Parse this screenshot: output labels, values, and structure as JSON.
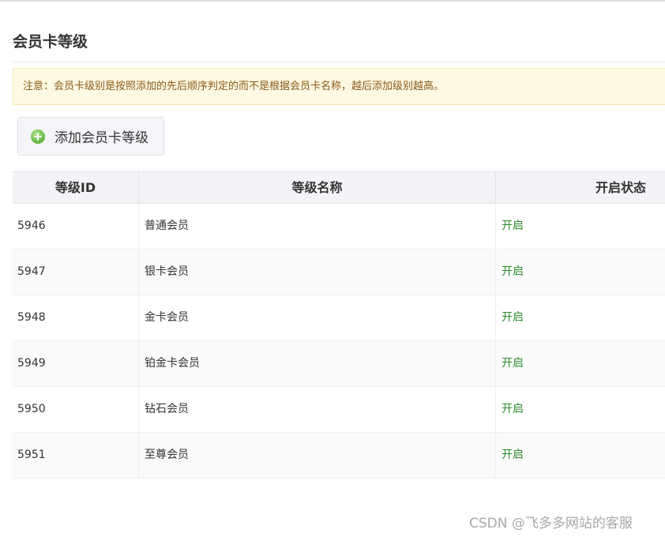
{
  "page": {
    "title": "会员卡等级"
  },
  "notice": {
    "text": "注意：会员卡级别是按照添加的先后顺序判定的而不是根据会员卡名称，越后添加级别越高。"
  },
  "toolbar": {
    "add_label": "添加会员卡等级",
    "add_icon": "plus-circle-icon"
  },
  "table": {
    "columns": [
      "等级ID",
      "等级名称",
      "开启状态"
    ],
    "rows": [
      {
        "id": "5946",
        "name": "普通会员",
        "status": "开启"
      },
      {
        "id": "5947",
        "name": "银卡会员",
        "status": "开启"
      },
      {
        "id": "5948",
        "name": "金卡会员",
        "status": "开启"
      },
      {
        "id": "5949",
        "name": "铂金卡会员",
        "status": "开启"
      },
      {
        "id": "5950",
        "name": "钻石会员",
        "status": "开启"
      },
      {
        "id": "5951",
        "name": "至尊会员",
        "status": "开启"
      }
    ]
  },
  "colors": {
    "status_enabled": "#2e8b2e",
    "notice_background": "#fdf9e3",
    "notice_text": "#8a5a1b"
  },
  "watermark": {
    "text": "CSDN @飞多多网站的客服"
  }
}
